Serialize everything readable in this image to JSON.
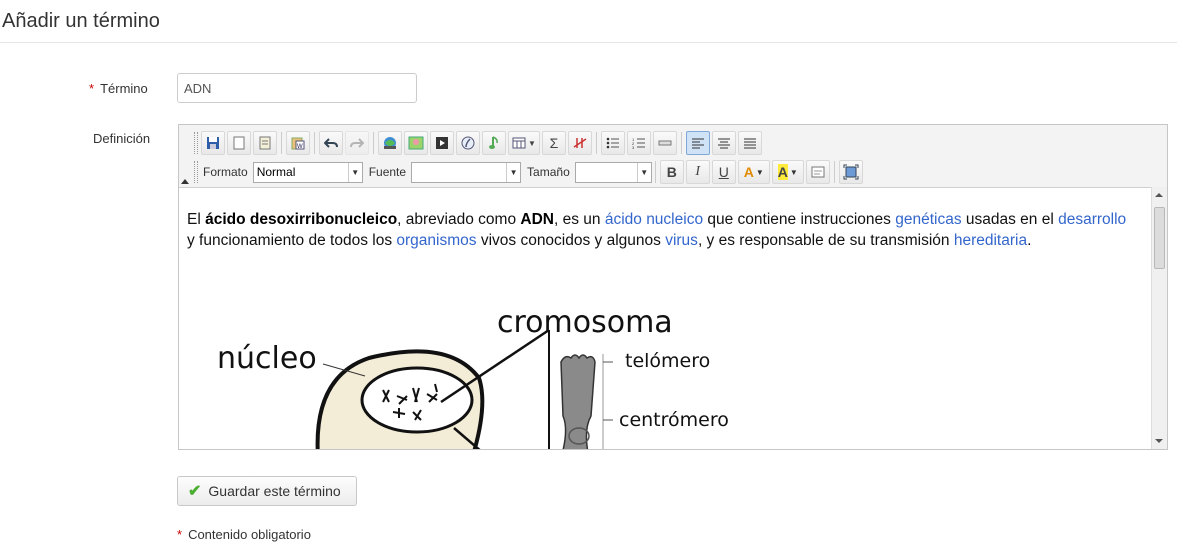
{
  "page": {
    "title": "Añadir un término"
  },
  "form": {
    "term_label": "Término",
    "term_required_marker": "*",
    "term_value": "ADN",
    "definition_label": "Definición",
    "save_label": "Guardar este término",
    "required_note_marker": "*",
    "required_note": "Contenido obligatorio"
  },
  "toolbar": {
    "row1_icons": [
      "save-icon",
      "new-document-icon",
      "paste-text-icon",
      "paste-word-icon",
      "undo-icon",
      "redo-icon",
      "insert-link-icon",
      "insert-image-icon",
      "insert-video-icon",
      "insert-flash-icon",
      "insert-audio-icon",
      "insert-table-icon",
      "insert-equation-icon",
      "strikethrough-icon",
      "bullet-list-icon",
      "numbered-list-icon",
      "horizontal-rule-icon",
      "align-left-icon",
      "align-center-icon",
      "align-justify-icon"
    ],
    "format_label": "Formato",
    "format_value": "Normal",
    "font_label": "Fuente",
    "font_value": "",
    "size_label": "Tamaño",
    "size_value": "",
    "bold": "B",
    "italic": "I",
    "underline": "U",
    "text_color": "A",
    "highlight_color": "A"
  },
  "content": {
    "p1": "El ",
    "p2": "ácido desoxirribonucleico",
    "p3": ", abreviado como ",
    "p4": "ADN",
    "p5": ", es un ",
    "link1": "ácido nucleico",
    "p6": " que contiene instrucciones ",
    "link2": "genéticas",
    "p7": " usadas en el ",
    "link3": "desarrollo",
    "p8": " y funcionamiento de todos los ",
    "link4": "organismos",
    "p9": " vivos conocidos y algunos ",
    "link5": "virus",
    "p10": ", y es responsable de su transmisión ",
    "link6": "hereditaria",
    "p11": ".",
    "figure": {
      "nucleus_label": "núcleo",
      "chromosome_label": "cromosoma",
      "telomere_label": "telómero",
      "centromere_label": "centrómero"
    }
  },
  "colors": {
    "link": "#3366cc",
    "required": "#cc0000",
    "check": "#4caf30"
  }
}
